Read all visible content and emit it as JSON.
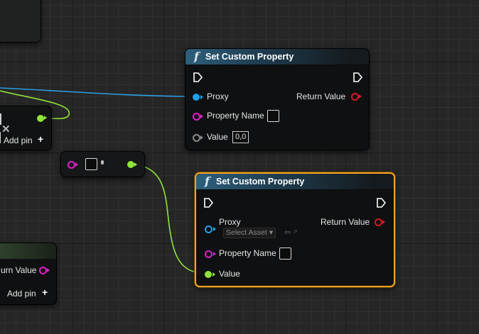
{
  "colors": {
    "grid_bg": "#262626",
    "exec_wire": "#ffffff",
    "proxy_wire": "#2b9fe2",
    "vector_wire": "#8fe43a",
    "selection_outline": "#f5a623",
    "header_blue": "#2e5f7c"
  },
  "node_top": {
    "title": "Set Custom Property",
    "func_icon": "f",
    "pins": {
      "proxy": "Proxy",
      "property_name": "Property Name",
      "value": "Value",
      "value_default": "0,0",
      "return_value": "Return Value"
    }
  },
  "node_bottom": {
    "title": "Set Custom Property",
    "func_icon": "f",
    "selected": true,
    "pins": {
      "proxy": "Proxy",
      "select_asset": "Select Asset",
      "property_name": "Property Name",
      "value": "Value",
      "return_value": "Return Value"
    }
  },
  "make_node": {
    "add_pin": "Add pin"
  },
  "left_node_bottom": {
    "return_value_partial": "urn Value",
    "add_pin": "Add pin"
  },
  "glyphs": {
    "plus": "+",
    "x_icon": "✕",
    "dropdown_arrow": "▾",
    "browse_icon": "⇦",
    "search_icon": "⌕"
  }
}
